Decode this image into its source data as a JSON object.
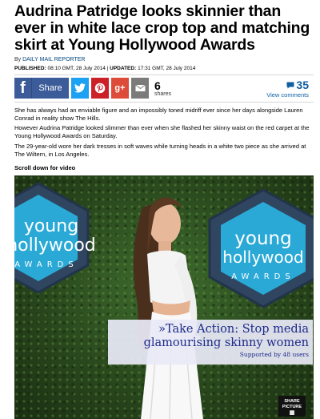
{
  "article": {
    "headline": "Audrina Patridge looks skinnier than ever in white lace crop top and matching skirt at Young Hollywood Awards",
    "byline_prefix": "By",
    "author": "DAILY MAIL REPORTER",
    "published_label": "PUBLISHED:",
    "published_value": "08:10 GMT, 28 July 2014",
    "separator": "|",
    "updated_label": "UPDATED:",
    "updated_value": "17:31 GMT, 28 July 2014",
    "paragraphs": [
      "She has always had an enviable figure and an impossibly toned midriff ever since her days alongside Lauren Conrad in reality show The Hills.",
      "However Audrina Patridge looked slimmer than ever when she flashed her skinny waist on the red carpet at the Young Hollywood Awards on Saturday.",
      "The 29-year-old wore her dark tresses in soft waves while turning heads in a white two piece as she arrived at The Wiltern, in Los Angeles."
    ],
    "scroll_note": "Scroll down for video"
  },
  "share": {
    "facebook_label": "Share",
    "share_count": "6",
    "shares_label": "shares",
    "comment_count": "35",
    "comments_label": "View comments",
    "icons": [
      "facebook-icon",
      "twitter-icon",
      "pinterest-icon",
      "google-plus-icon",
      "email-icon",
      "speech-bubble-icon"
    ]
  },
  "photo": {
    "sign_left": {
      "line1": "young",
      "line2": "hollywood",
      "line3": "AWARDS"
    },
    "sign_right": {
      "line1": "young",
      "line2": "hollywood",
      "line3": "AWARDS"
    },
    "promo_title": "»Take Action: Stop media glamourising skinny women",
    "promo_sub": "Supported by 48 users",
    "share_picture_line1": "SHARE",
    "share_picture_line2": "PICTURE"
  },
  "colors": {
    "facebook": "#3b5b99",
    "twitter": "#1da1f2",
    "pinterest": "#cb2027",
    "google_plus": "#dd4b39",
    "email": "#7b7b7b",
    "comments": "#0f5fa5",
    "link": "#00457f",
    "promo_text": "#1d2a8a",
    "sign_blue": "#2aa9d6"
  }
}
